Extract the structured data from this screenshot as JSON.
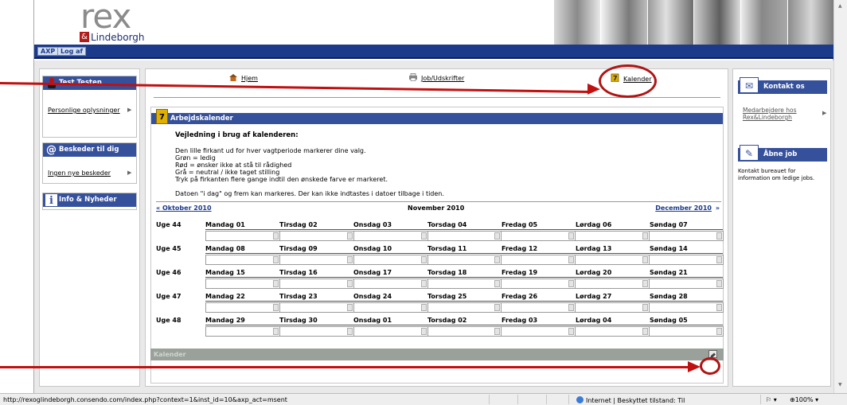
{
  "header": {
    "logo_rex": "rex",
    "logo_amp": "&",
    "logo_lindeborgh": "Lindeborgh"
  },
  "navbar": {
    "axp_label": "AXP",
    "logout_label": "Log af"
  },
  "left": {
    "user_name": "Test Testen",
    "personal_info_link": "Personlige oplysninger",
    "messages_title": "Beskeder til dig",
    "no_messages_link": "Ingen nye beskeder",
    "info_title": "Info & Nyheder"
  },
  "topnav": {
    "home": "Hjem",
    "jobs": "Job/Udskrifter",
    "calendar": "Kalender"
  },
  "panel": {
    "title": "Arbejdskalender",
    "intro_title": "Vejledning i brug af kalenderen:",
    "intro_lines": [
      "Den lille firkant ud for hver vagtperiode markerer dine valg.",
      "Grøn = ledig",
      "Rød = ønsker ikke at stå til rådighed",
      "Grå = neutral / ikke taget stilling",
      "Tryk på firkanten flere gange indtil den ønskede farve er markeret."
    ],
    "intro_note": "Datoen \"i dag\" og frem kan markeres. Der kan ikke indtastes i datoer tilbage i tiden.",
    "prev_arrow": "«",
    "prev_month": "Oktober 2010",
    "current_month": "November 2010",
    "next_month": "December 2010",
    "next_arrow": "»",
    "weeks": [
      {
        "label": "Uge 44",
        "days": [
          "Mandag 01",
          "Tirsdag 02",
          "Onsdag 03",
          "Torsdag 04",
          "Fredag 05",
          "Lørdag 06",
          "Søndag 07"
        ]
      },
      {
        "label": "Uge 45",
        "days": [
          "Mandag 08",
          "Tirsdag 09",
          "Onsdag 10",
          "Torsdag 11",
          "Fredag 12",
          "Lørdag 13",
          "Søndag 14"
        ]
      },
      {
        "label": "Uge 46",
        "days": [
          "Mandag 15",
          "Tirsdag 16",
          "Onsdag 17",
          "Torsdag 18",
          "Fredag 19",
          "Lørdag 20",
          "Søndag 21"
        ]
      },
      {
        "label": "Uge 47",
        "days": [
          "Mandag 22",
          "Tirsdag 23",
          "Onsdag 24",
          "Torsdag 25",
          "Fredag 26",
          "Lørdag 27",
          "Søndag 28"
        ]
      },
      {
        "label": "Uge 48",
        "days": [
          "Mandag 29",
          "Tirsdag 30",
          "Onsdag 01",
          "Torsdag 02",
          "Fredag 03",
          "Lørdag 04",
          "Søndag 05"
        ]
      }
    ],
    "footer_label": "Kalender"
  },
  "right": {
    "contact_title": "Kontakt os",
    "contact_link": "Medarbejdere hos Rex&Lindeborgh",
    "jobs_title": "Åbne job",
    "jobs_text": "Kontakt bureauet for information om ledige jobs."
  },
  "statusbar": {
    "url": "http://rexoglindeborgh.consendo.com/index.php?context=1&inst_id=10&axp_act=msent",
    "zone": "Internet | Beskyttet tilstand: Til",
    "zoom": "100%"
  },
  "colors": {
    "nav_blue": "#1c3a8a",
    "header_blue": "#36519c",
    "annotation_red": "#c01010"
  }
}
